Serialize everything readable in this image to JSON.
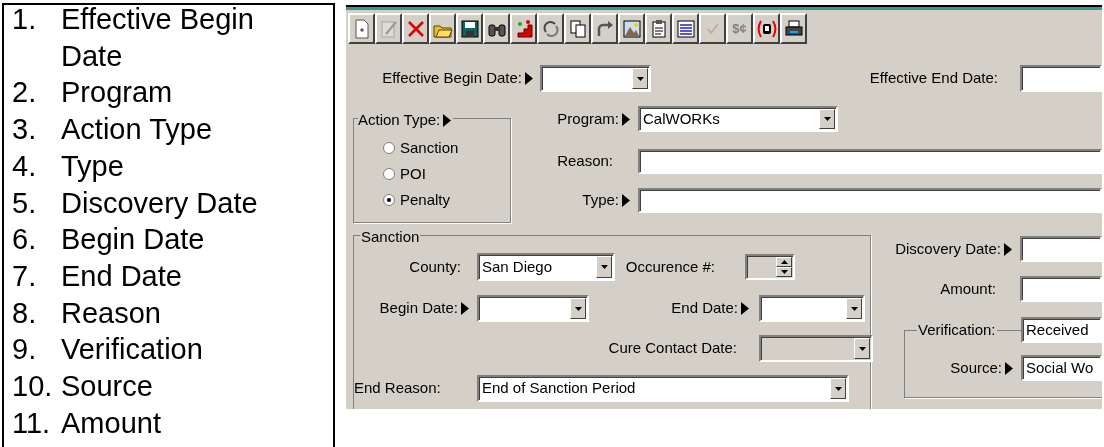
{
  "document_list": [
    {
      "number": "1.",
      "text": "Effective Begin Date"
    },
    {
      "number": "2.",
      "text": "Program"
    },
    {
      "number": "3.",
      "text": "Action Type"
    },
    {
      "number": "4.",
      "text": "Type"
    },
    {
      "number": "5.",
      "text": "Discovery Date"
    },
    {
      "number": "6.",
      "text": "Begin Date"
    },
    {
      "number": "7.",
      "text": "End Date"
    },
    {
      "number": "8.",
      "text": "Reason"
    },
    {
      "number": "9.",
      "text": "Verification"
    },
    {
      "number": "10.",
      "text": "Source"
    },
    {
      "number": "11.",
      "text": "Amount"
    }
  ],
  "app": {
    "toolbar": [
      {
        "kind": "new",
        "disabled": false
      },
      {
        "kind": "edit",
        "disabled": true
      },
      {
        "kind": "delete",
        "disabled": false
      },
      {
        "kind": "open",
        "disabled": false
      },
      {
        "kind": "save",
        "disabled": false
      },
      {
        "kind": "find",
        "disabled": false
      },
      {
        "kind": "chart",
        "disabled": false
      },
      {
        "kind": "refresh",
        "disabled": false
      },
      {
        "kind": "copy",
        "disabled": false
      },
      {
        "kind": "redo",
        "disabled": false
      },
      {
        "kind": "image",
        "disabled": false
      },
      {
        "kind": "clipboard",
        "disabled": false
      },
      {
        "kind": "form",
        "disabled": false
      },
      {
        "kind": "check",
        "disabled": true
      },
      {
        "kind": "text",
        "label": "$¢",
        "disabled": true
      },
      {
        "kind": "bracket",
        "disabled": false
      },
      {
        "kind": "print",
        "disabled": false
      }
    ],
    "effective_begin_date": {
      "label": "Effective Begin Date:",
      "required": true,
      "kind": "dropdown",
      "disabled": false
    },
    "effective_end_date": {
      "label": "Effective End Date:",
      "kind": "text",
      "disabled": false
    },
    "action_type": {
      "label": "Action Type:",
      "required": true,
      "options": [
        {
          "label": "Sanction",
          "selected": false
        },
        {
          "label": "POI",
          "selected": false
        },
        {
          "label": "Penalty",
          "selected": true
        }
      ]
    },
    "program": {
      "label": "Program:",
      "required": true,
      "kind": "dropdown",
      "disabled": false,
      "value": "CalWORKs"
    },
    "reason": {
      "label": "Reason:",
      "kind": "text",
      "disabled": false
    },
    "type": {
      "label": "Type:",
      "required": true,
      "kind": "text",
      "disabled": false
    },
    "sanction": {
      "title": "Sanction",
      "county": {
        "label": "County:",
        "kind": "dropdown",
        "disabled": false,
        "value": "San Diego"
      },
      "occurrence": {
        "label": "Occurence #:",
        "kind": "spinner",
        "disabled": true
      },
      "begin_date": {
        "label": "Begin Date:",
        "required": true,
        "kind": "dropdown",
        "disabled": false
      },
      "end_date": {
        "label": "End Date:",
        "required": true,
        "kind": "dropdown",
        "disabled": false
      },
      "cure_contact_date": {
        "label": "Cure Contact Date:",
        "kind": "dropdown",
        "disabled": true
      },
      "end_reason": {
        "label": "End Reason:",
        "kind": "dropdown",
        "disabled": false,
        "value": "End of Sanction Period"
      }
    },
    "discovery_date": {
      "label": "Discovery Date:",
      "required": true,
      "kind": "text",
      "disabled": false
    },
    "amount": {
      "label": "Amount:",
      "kind": "text",
      "disabled": false
    },
    "verification": {
      "label": "Verification:",
      "kind": "text",
      "disabled": false,
      "value": "Received"
    },
    "source": {
      "label": "Source:",
      "required": true,
      "kind": "text",
      "disabled": false,
      "value": "Social Wo"
    }
  }
}
